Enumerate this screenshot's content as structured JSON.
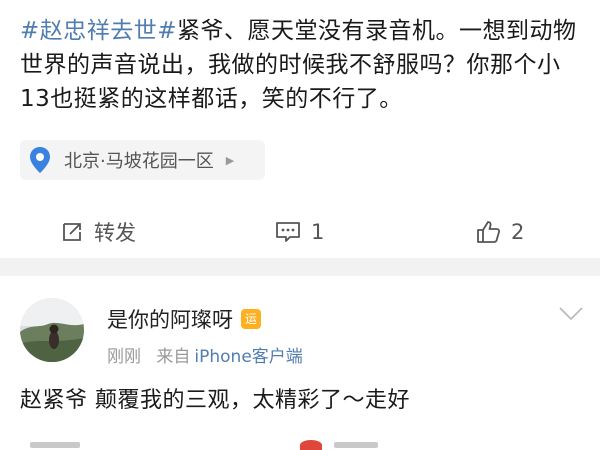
{
  "post": {
    "hashtag": "#赵忠祥去世#",
    "text": "紧爷、愿天堂没有录音机。一想到动物世界的声音说出，我做的时候我不舒服吗？你那个小13也挺紧的这样都话，笑的不行了。",
    "location": "北京·马坡花园一区"
  },
  "actions": {
    "repost_label": "转发",
    "comment_count": "1",
    "like_count": "2"
  },
  "comment": {
    "username": "是你的阿璨呀",
    "badge": "运",
    "time": "刚刚",
    "source_prefix": "来自",
    "source": "iPhone客户端",
    "text": "赵紧爷 颠覆我的三观，太精彩了～走好"
  },
  "colors": {
    "hashtag": "#507daf",
    "location_pin": "#3b82e0",
    "separator": "#f2f2f2"
  },
  "icons": [
    "location-pin-icon",
    "repost-icon",
    "comment-icon",
    "like-icon",
    "chevron-down-icon"
  ]
}
